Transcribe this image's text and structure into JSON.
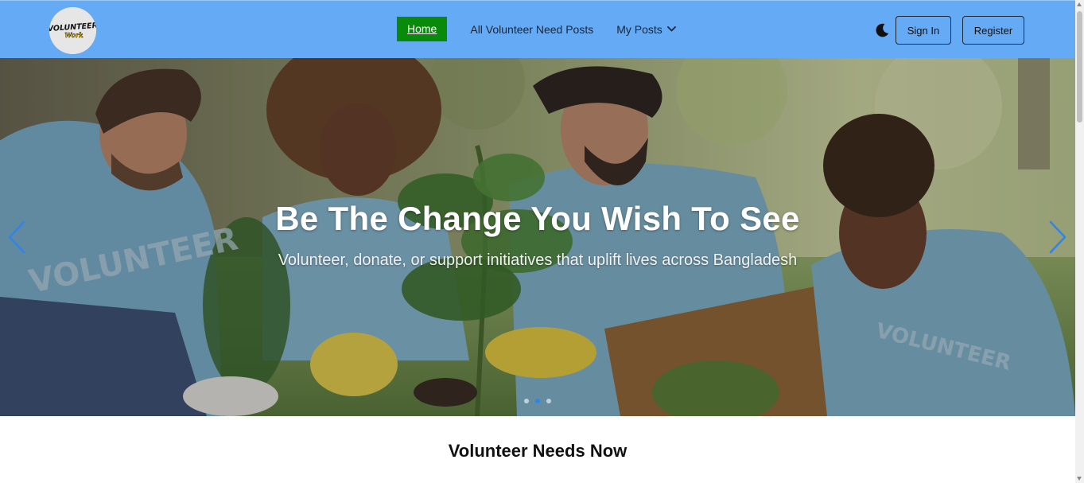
{
  "brand": {
    "logo_text_top": "VOLUNTEER",
    "logo_text_bottom": "Work",
    "logo_colors": {
      "black": "#111111",
      "yellow": "#f2c200"
    }
  },
  "nav": {
    "home": "Home",
    "all_posts": "All Volunteer Need Posts",
    "my_posts": "My Posts",
    "my_posts_icon": "chevron-down-icon",
    "theme_toggle_icon": "moon-icon",
    "sign_in": "Sign In",
    "register": "Register"
  },
  "hero": {
    "title": "Be The Change You Wish To See",
    "subtitle": "Volunteer, donate, or support initiatives that uplift lives across Bangladesh",
    "prev_icon": "chevron-left-icon",
    "next_icon": "chevron-right-icon",
    "slide_count": 3,
    "active_slide": 1,
    "shirt_text": "VOLUNTEER"
  },
  "section": {
    "title": "Volunteer Needs Now"
  },
  "colors": {
    "navbar": "#64aaf5",
    "home_active": "#0a8a0a",
    "accent": "#2f86e8"
  }
}
